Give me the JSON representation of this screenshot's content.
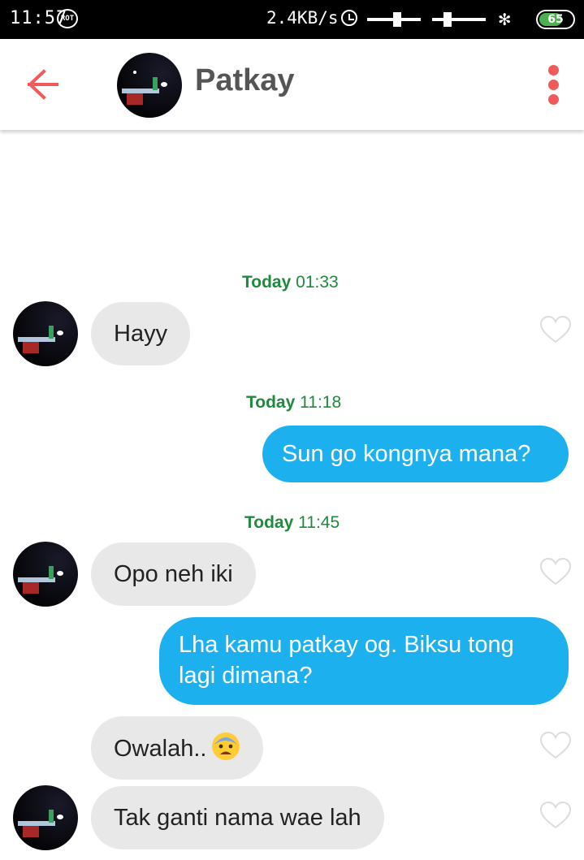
{
  "status_bar": {
    "time": "11:57",
    "app_badge": "ROT",
    "network_speed": "2.4KB/s",
    "battery_level": "65",
    "battery_fraction": 0.65
  },
  "header": {
    "contact_name": "Patkay",
    "back_icon": "arrow-left-icon",
    "menu_icon": "more-vertical-icon",
    "accent_color": "#f05a5a"
  },
  "messages": {
    "stamp1": {
      "day": "Today",
      "time": "01:33"
    },
    "stamp2": {
      "day": "Today",
      "time": "11:18"
    },
    "stamp3": {
      "day": "Today",
      "time": "11:45"
    },
    "msg1": "Hayy",
    "msg2": "Sun go kongnya mana?",
    "msg3": "Opo neh iki",
    "msg4_line1": "Lha kamu patkay og. Biksu tong",
    "msg4_line2": "lagi dimana?",
    "msg5": "Owalah..",
    "msg5_emoji": "anxious-face-emoji",
    "msg6": "Tak ganti nama wae lah"
  },
  "colors": {
    "outgoing_bubble": "#1cb1ee",
    "incoming_bubble": "#e8e8e8",
    "timestamp": "#1f8a3c"
  }
}
